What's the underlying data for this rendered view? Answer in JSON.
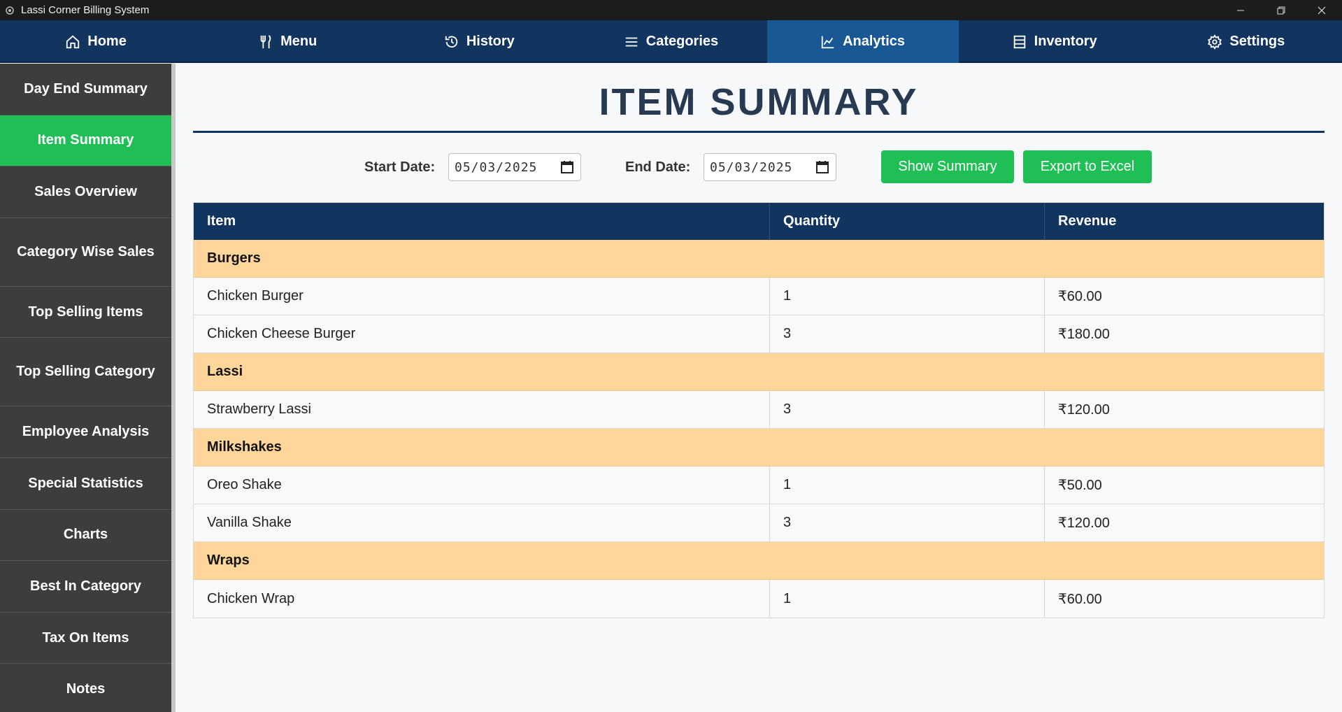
{
  "window": {
    "title": "Lassi Corner Billing System"
  },
  "nav": {
    "home": "Home",
    "menu": "Menu",
    "history": "History",
    "categories": "Categories",
    "analytics": "Analytics",
    "inventory": "Inventory",
    "settings": "Settings"
  },
  "sidebar": {
    "items": [
      "Day End Summary",
      "Item Summary",
      "Sales Overview",
      "Category Wise Sales",
      "Top Selling Items",
      "Top Selling Category",
      "Employee Analysis",
      "Special Statistics",
      "Charts",
      "Best In Category",
      "Tax On Items",
      "Notes"
    ]
  },
  "main": {
    "title": "ITEM SUMMARY",
    "start_label": "Start Date:",
    "start_value": "05/03/2025",
    "end_label": "End Date:",
    "end_value": "05/03/2025",
    "show_button": "Show Summary",
    "export_button": "Export to Excel"
  },
  "table": {
    "headers": [
      "Item",
      "Quantity",
      "Revenue"
    ],
    "groups": [
      {
        "category": "Burgers",
        "rows": [
          {
            "item": "Chicken Burger",
            "qty": "1",
            "revenue": "₹60.00"
          },
          {
            "item": "Chicken Cheese Burger",
            "qty": "3",
            "revenue": "₹180.00"
          }
        ]
      },
      {
        "category": "Lassi",
        "rows": [
          {
            "item": "Strawberry Lassi",
            "qty": "3",
            "revenue": "₹120.00"
          }
        ]
      },
      {
        "category": "Milkshakes",
        "rows": [
          {
            "item": "Oreo Shake",
            "qty": "1",
            "revenue": "₹50.00"
          },
          {
            "item": "Vanilla Shake",
            "qty": "3",
            "revenue": "₹120.00"
          }
        ]
      },
      {
        "category": "Wraps",
        "rows": [
          {
            "item": "Chicken Wrap",
            "qty": "1",
            "revenue": "₹60.00"
          }
        ]
      }
    ]
  },
  "colors": {
    "nav_bg": "#12355f",
    "nav_active": "#1a5795",
    "sidebar_bg": "#3d3d3d",
    "accent_green": "#1fbf55",
    "category_row": "#ffd699"
  }
}
